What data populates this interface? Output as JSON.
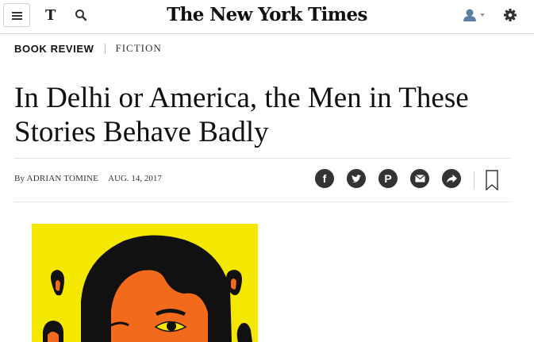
{
  "masthead": {
    "title": "The New York Times",
    "logo_letter": "T"
  },
  "icons": {
    "menu": "hamburger-menu-icon",
    "search": "search-icon",
    "user": "user-icon",
    "settings": "gear-icon",
    "bookmark": "bookmark-icon"
  },
  "section": {
    "kicker": "BOOK REVIEW",
    "subkicker": "FICTION"
  },
  "headline": "In Delhi or America, the Men in These Stories Behave Badly",
  "byline": {
    "author": "By ADRIAN TOMINE",
    "date": "AUG. 14, 2017"
  },
  "share": [
    {
      "name": "facebook-icon",
      "label": "f"
    },
    {
      "name": "twitter-icon",
      "label": ""
    },
    {
      "name": "pinterest-icon",
      "label": "P"
    },
    {
      "name": "email-icon",
      "label": ""
    },
    {
      "name": "share-more-icon",
      "label": ""
    }
  ],
  "colors": {
    "art_yellow": "#f5e800",
    "art_orange": "#f26a1b",
    "art_black": "#111111",
    "share_button": "#333333"
  }
}
